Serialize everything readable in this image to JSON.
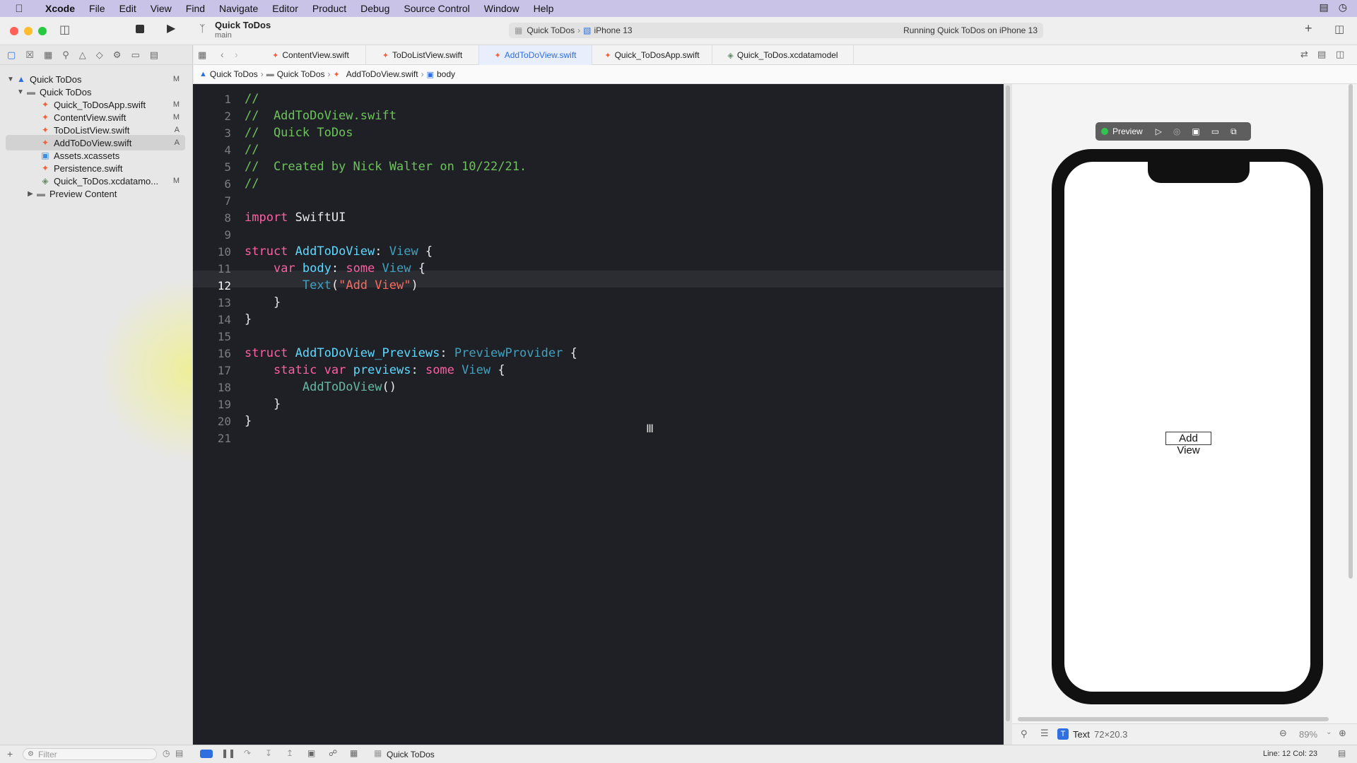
{
  "menubar": {
    "items": [
      "Xcode",
      "File",
      "Edit",
      "View",
      "Find",
      "Navigate",
      "Editor",
      "Product",
      "Debug",
      "Source Control",
      "Window",
      "Help"
    ]
  },
  "toolbar": {
    "project_title": "Quick ToDos",
    "branch": "main",
    "scheme": "Quick ToDos",
    "device": "iPhone 13",
    "status": "Running Quick ToDos on iPhone 13"
  },
  "tabs": [
    "ContentView.swift",
    "ToDoListView.swift",
    "AddToDoView.swift",
    "Quick_ToDosApp.swift",
    "Quick_ToDos.xcdatamodel"
  ],
  "breadcrumb": [
    "Quick ToDos",
    "Quick ToDos",
    "AddToDoView.swift",
    "body"
  ],
  "navigator": {
    "rows": [
      {
        "label": "Quick ToDos",
        "badge": "M"
      },
      {
        "label": "Quick ToDos",
        "badge": ""
      },
      {
        "label": "Quick_ToDosApp.swift",
        "badge": "M"
      },
      {
        "label": "ContentView.swift",
        "badge": "M"
      },
      {
        "label": "ToDoListView.swift",
        "badge": "A"
      },
      {
        "label": "AddToDoView.swift",
        "badge": "A"
      },
      {
        "label": "Assets.xcassets",
        "badge": ""
      },
      {
        "label": "Persistence.swift",
        "badge": ""
      },
      {
        "label": "Quick_ToDos.xcdatamo...",
        "badge": "M"
      },
      {
        "label": "Preview Content",
        "badge": ""
      }
    ],
    "filter_placeholder": "Filter"
  },
  "editor": {
    "line_numbers": [
      "1",
      "2",
      "3",
      "4",
      "5",
      "6",
      "7",
      "8",
      "9",
      "10",
      "11",
      "12",
      "13",
      "14",
      "15",
      "16",
      "17",
      "18",
      "19",
      "20",
      "21"
    ],
    "current_line": "12",
    "code": {
      "l1": "//",
      "l2": "//  AddToDoView.swift",
      "l3": "//  Quick ToDos",
      "l4": "//",
      "l5": "//  Created by Nick Walter on 10/22/21.",
      "l6": "//",
      "kw_import": "import",
      "mod_swiftui": " SwiftUI",
      "kw_struct": "struct",
      "t_addtodoview": " AddToDoView",
      "colon": ": ",
      "t_view": "View",
      "brace_open": " {",
      "kw_var": "var",
      "p_body": " body",
      "kw_some": "some",
      "fn_text": "Text",
      "paren_open": "(",
      "str_addview": "\"Add View\"",
      "paren_close": ")",
      "brace_close": "}",
      "t_previews_struct": " AddToDoView_Previews",
      "t_previewprovider": "PreviewProvider",
      "kw_static": "static",
      "p_previews": " previews",
      "fn_addtodoview": "AddToDoView",
      "call_parens": "()"
    }
  },
  "preview": {
    "label": "Preview",
    "text": "Add View",
    "inspector_type": "T",
    "inspector_label": "Text",
    "inspector_size": "72×20.3",
    "zoom": "89%"
  },
  "statusbar": {
    "scheme": "Quick ToDos",
    "position": "Line: 12  Col: 23"
  }
}
